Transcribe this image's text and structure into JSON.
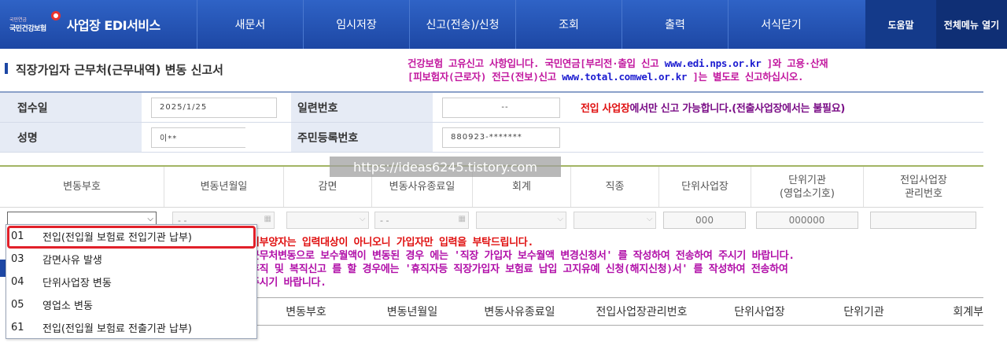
{
  "app": {
    "org_small": "국민연금",
    "org": "국민건강보험",
    "title": "사업장 EDI서비스"
  },
  "nav": {
    "items": [
      "새문서",
      "임시저장",
      "신고(전송)/신청",
      "조회",
      "출력",
      "서식닫기"
    ],
    "help": "도움말",
    "all_menu": "전체메뉴 열기"
  },
  "page": {
    "title": "직장가입자 근무처(근무내역) 변동 신고서",
    "notice_line1_a": "건강보험 고유신고 사항입니다. 국민연금[부리전·출입 신고 ",
    "notice_line1_url": "www.edi.nps.or.kr",
    "notice_line1_b": " ]와 고용·산재",
    "notice_line2_a": "[피보험자(근로자) 전근(전보)신고 ",
    "notice_line2_url": "www.total.comwel.or.kr",
    "notice_line2_b": " ]는 별도로 신고하십시오."
  },
  "form": {
    "receipt_label": "접수일",
    "receipt_value": "2025/1/25",
    "serial_label": "일련번호",
    "serial_value": "--",
    "note_red": "전입 사업장",
    "note_rest": "에서만 신고 가능합니다.(전출사업장에서는 불필요)",
    "name_label": "성명",
    "name_value": "이**",
    "rrn_label": "주민등록번호",
    "rrn_value": "880923-*******"
  },
  "watermark": "https://ideas6245.tistory.com",
  "grid": {
    "headers": [
      "변동부호",
      "변동년월일",
      "감면",
      "변동사유종료일",
      "회계",
      "직종",
      "단위사업장",
      "단위기관\n(영업소기호)",
      "전입사업장\n관리번호"
    ],
    "date_placeholder": "-  -",
    "unit_site": "000",
    "unit_org": "000000"
  },
  "dropdown": {
    "items": [
      {
        "code": "01",
        "label": "전입(전입월 보험료 전입기관 납부)"
      },
      {
        "code": "03",
        "label": "감면사유 발생"
      },
      {
        "code": "04",
        "label": "단위사업장 변동"
      },
      {
        "code": "05",
        "label": "영업소 변동"
      },
      {
        "code": "61",
        "label": "전입(전입월 보험료 전출기관 납부)"
      }
    ]
  },
  "notes": {
    "line1": "피부양자는 입력대상이 아니오니 가입자만 입력을 부탁드립니다.",
    "line2": "근무처변동으로 보수월액이 변동된 경우 에는 '직장 가입자 보수월액 변경신청서' 를 작성하여 전송하여 주시기 바랍니다.",
    "line3": "휴직 및 복직신고 를 할 경우에는 '휴직자등 직장가입자 보험료 납입 고지유예 신청(해지신청)서' 를 작성하여 전송하여",
    "line4": "주시기 바랍니다."
  },
  "list": {
    "headers": [
      "변동부호",
      "변동년월일",
      "변동사유종료일",
      "전입사업장관리번호",
      "단위사업장",
      "단위기관",
      "회계부"
    ]
  },
  "colors": {
    "nav_bg": "#2f63c6",
    "highlight": "#e1202a",
    "notice": "#c2189f"
  }
}
